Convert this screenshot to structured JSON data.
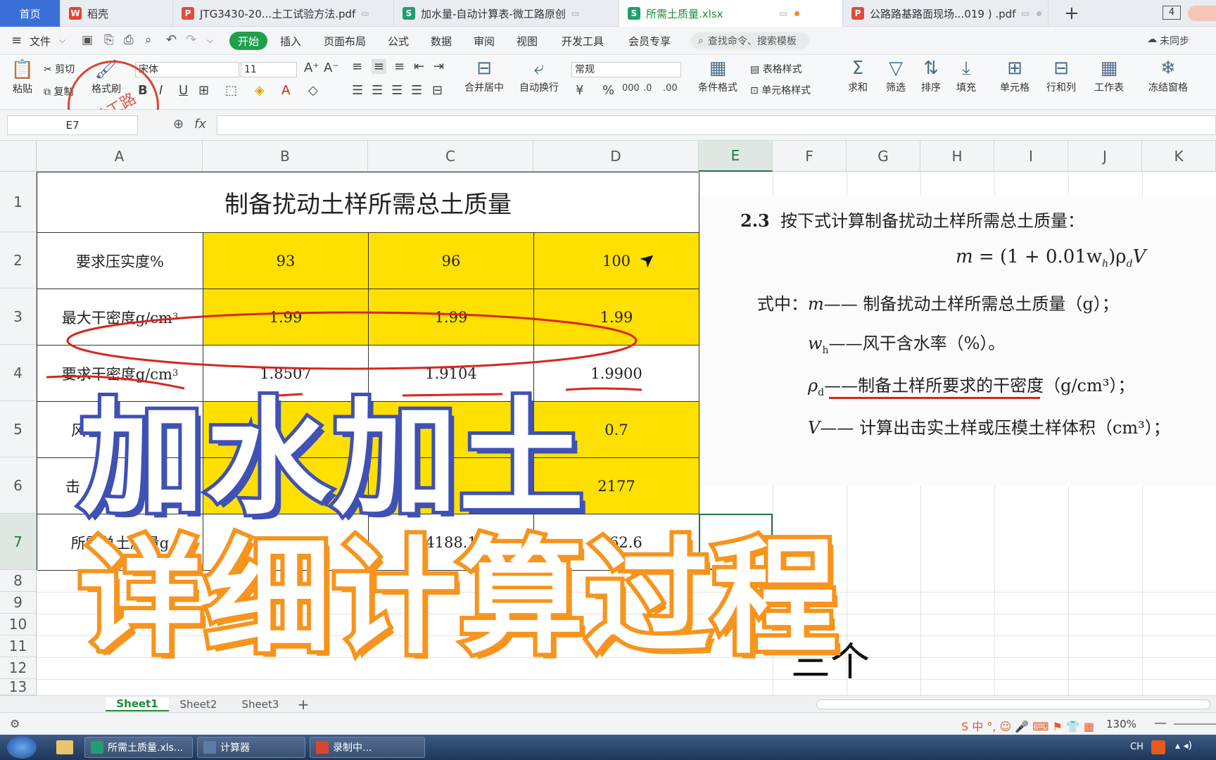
{
  "tabs": [
    {
      "label": "首页",
      "type": "home"
    },
    {
      "label": "稻壳",
      "type": "wps"
    },
    {
      "label": "JTG3430-20...土工试验方法.pdf",
      "type": "pdf"
    },
    {
      "label": "加水量-自动计算表-微工路原创",
      "type": "xls"
    },
    {
      "label": "所需土质量.xlsx",
      "type": "xls",
      "active": true
    },
    {
      "label": "公路路基路面现场...019 ) .pdf",
      "type": "pdf"
    }
  ],
  "tab_count": "4",
  "menu": {
    "file": "文件",
    "items": [
      "开始",
      "插入",
      "页面布局",
      "公式",
      "数据",
      "审阅",
      "视图",
      "开发工具",
      "会员专享"
    ],
    "search_placeholder": "查找命令、搜索模板",
    "sync": "未同步"
  },
  "ribbon": {
    "paste": "粘贴",
    "cut": "剪切",
    "copy": "复制",
    "format_painter": "格式刷",
    "font_name": "宋体",
    "font_size": "11",
    "merge_center": "合并居中",
    "wrap": "自动换行",
    "number_format": "常规",
    "conditional": "条件格式",
    "table_style": "表格样式",
    "cell_style": "单元格样式",
    "sum": "求和",
    "filter": "筛选",
    "sort": "排序",
    "fill": "填充",
    "cell": "单元格",
    "rowcol": "行和列",
    "worksheet": "工作表",
    "freeze": "冻结窗格"
  },
  "formula": {
    "cell_ref": "E7",
    "fx": "fx",
    "value": ""
  },
  "stamp_text": "微工路",
  "columns": [
    "A",
    "B",
    "C",
    "D",
    "E",
    "F",
    "G",
    "H",
    "I",
    "J",
    "K"
  ],
  "rows": [
    "1",
    "2",
    "3",
    "4",
    "5",
    "6",
    "7",
    "8",
    "9",
    "10",
    "11",
    "12",
    "13"
  ],
  "table": {
    "title": "制备扰动土样所需总土质量",
    "r2": {
      "label": "要求压实度%",
      "b": "93",
      "c": "96",
      "d": "100"
    },
    "r3": {
      "label": "最大干密度g/cm",
      "sup": "3",
      "b": "1.99",
      "c": "1.99",
      "d": "1.99"
    },
    "r4": {
      "label": "要求干密度g/cm",
      "sup": "3",
      "b": "1.8507",
      "c": "1.9104",
      "d": "1.9900"
    },
    "r5": {
      "label": "风",
      "d": "0.7"
    },
    "r6": {
      "label": "击",
      "d": "2177"
    },
    "r7": {
      "label": "所需总土质量g",
      "b": "4057.2",
      "c": "4188.1",
      "d": "4362.6"
    }
  },
  "book": {
    "section": "2.3",
    "heading": "按下式计算制备扰动土样所需总土质量：",
    "formula_m": "m",
    "formula_rest": "= (1 + 0.01w",
    "formula_sub_h": "h",
    "formula_close": ")ρ",
    "formula_sub_d": "d",
    "formula_V": "V",
    "where": "式中：",
    "m_sym": "m",
    "m_desc": "—— 制备扰动土样所需总土质量（g）；",
    "w_sym": "w",
    "w_sub": "h",
    "w_desc": "——风干含水率（%）。",
    "rho_sym": "ρ",
    "rho_sub": "d",
    "rho_desc": "——制备土样所要求的干密度（g/cm³）；",
    "v_sym": "V",
    "v_desc": "—— 计算出击实土样或压模土样体积（cm³）；"
  },
  "three_ge": "三个",
  "sheets": [
    "Sheet1",
    "Sheet2",
    "Sheet3"
  ],
  "zoom": "130%",
  "overlay": {
    "line1": "加水加土",
    "line2": "详细计算过程"
  },
  "taskbar": {
    "items": [
      "所需土质量.xls...",
      "计算器",
      "录制中..."
    ],
    "lang": "CH"
  },
  "colors": {
    "accent_green": "#1f9f4a",
    "highlight_yellow": "#ffe000",
    "annotation_red": "#d9251d",
    "overlay_blue": "#3f51b5",
    "overlay_orange": "#f7941d"
  }
}
